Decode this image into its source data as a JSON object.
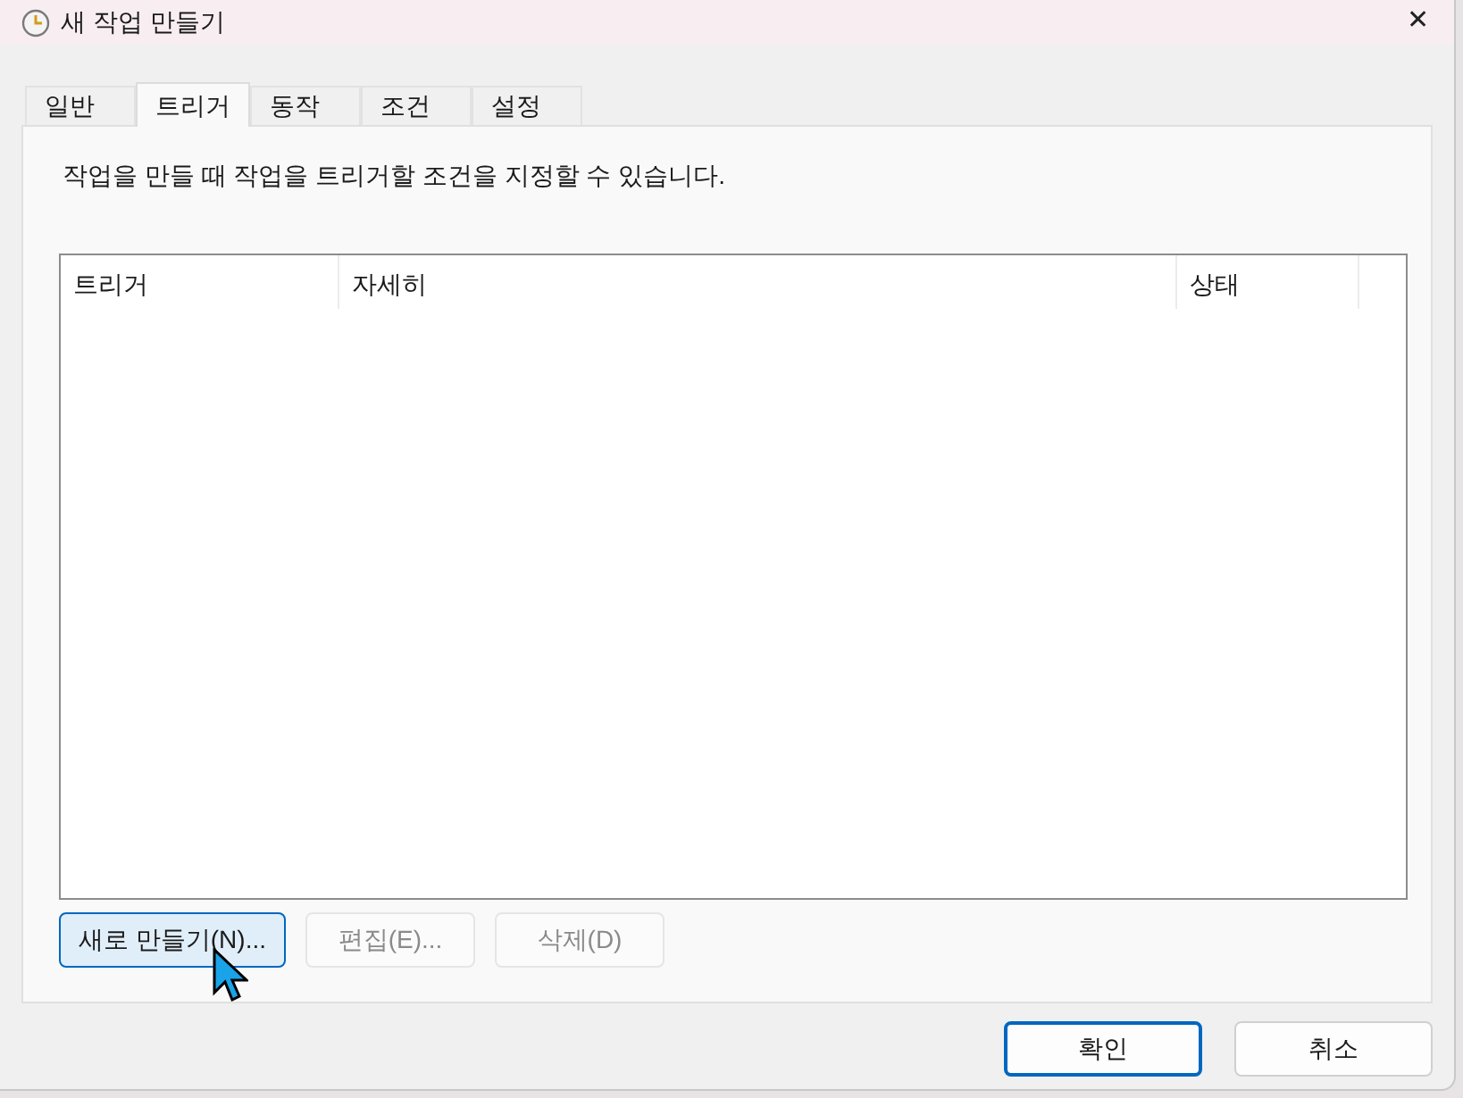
{
  "window": {
    "title": "새 작업 만들기",
    "close": "✕"
  },
  "tabs": [
    {
      "label": "일반",
      "selected": false
    },
    {
      "label": "트리거",
      "selected": true
    },
    {
      "label": "동작",
      "selected": false
    },
    {
      "label": "조건",
      "selected": false
    },
    {
      "label": "설정",
      "selected": false
    }
  ],
  "description": "작업을 만들 때 작업을 트리거할 조건을 지정할 수 있습니다.",
  "table": {
    "columns": [
      "트리거",
      "자세히",
      "상태"
    ]
  },
  "list_buttons": [
    {
      "label": "새로 만들기(N)...",
      "disabled": false,
      "hovered": true
    },
    {
      "label": "편집(E)...",
      "disabled": true,
      "hovered": false
    },
    {
      "label": "삭제(D)",
      "disabled": true,
      "hovered": false
    }
  ],
  "dialog_buttons": [
    {
      "label": "확인",
      "default": true
    },
    {
      "label": "취소",
      "default": false
    }
  ]
}
